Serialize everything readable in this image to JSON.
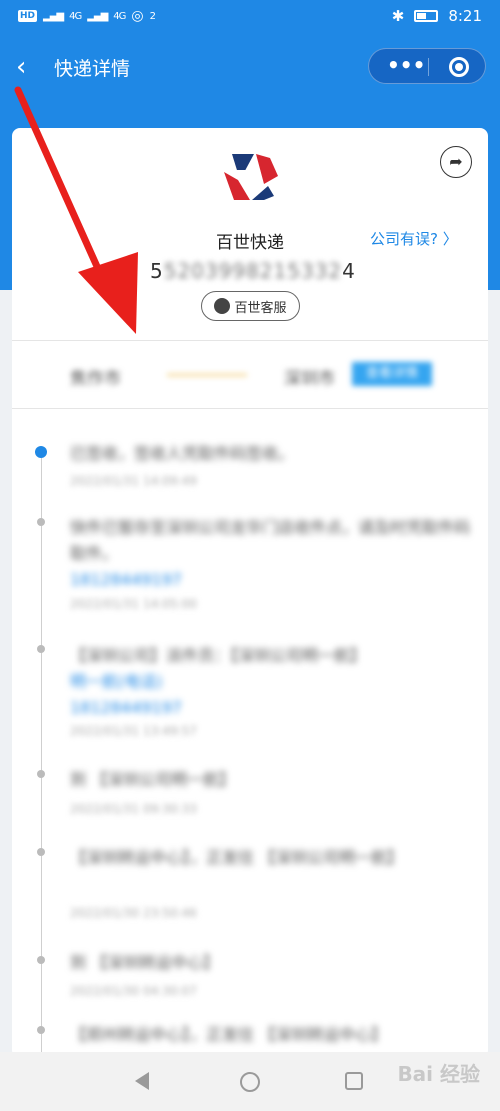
{
  "status": {
    "hd": "HD",
    "net1": "4G",
    "net2": "4G",
    "wifi_label": "2",
    "time": "8:21"
  },
  "nav": {
    "back_icon": "chevron-left-icon",
    "title": "快递详情"
  },
  "company": {
    "name": "百世快递",
    "wrong_link": "公司有误?",
    "tracking_prefix": "5",
    "tracking_masked": "5203998215332",
    "tracking_suffix": "4",
    "service_label": "百世客服",
    "brand_colors": [
      "#1b3a78",
      "#d7262f"
    ]
  },
  "route": {
    "from": "焦作市",
    "to": "深圳市",
    "button": "查看详情"
  },
  "timeline": [
    {
      "text": "已签收，签收人凭取件码签收。",
      "time": "2022/01/31 14:09:49",
      "active": true
    },
    {
      "text": "快件已暂存至深圳公司龙华门店收件点，请及时凭取件码取件。",
      "link": "18128449197",
      "time": "2022/01/31 14:05:00",
      "active": false
    },
    {
      "text": "【深圳公司】派件员：【深圳公司明一航】",
      "link_label": "明一航(电话)",
      "link": "18128449197",
      "time": "2022/01/31 13:49:57",
      "active": false
    },
    {
      "text": "到 【深圳公司明一航】",
      "time": "2022/01/31 09:30:33",
      "active": false
    },
    {
      "text": "【深圳转运中心】，正发往 【深圳公司明一航】",
      "time": "2022/01/30 23:50:46",
      "active": false
    },
    {
      "text": "到 【深圳转运中心】",
      "time": "2022/01/30 04:30:07",
      "active": false
    },
    {
      "text": "【郑州转运中心】，正发往 【深圳转运中心】",
      "time": "",
      "active": false
    }
  ],
  "watermark": "Bai 经验"
}
